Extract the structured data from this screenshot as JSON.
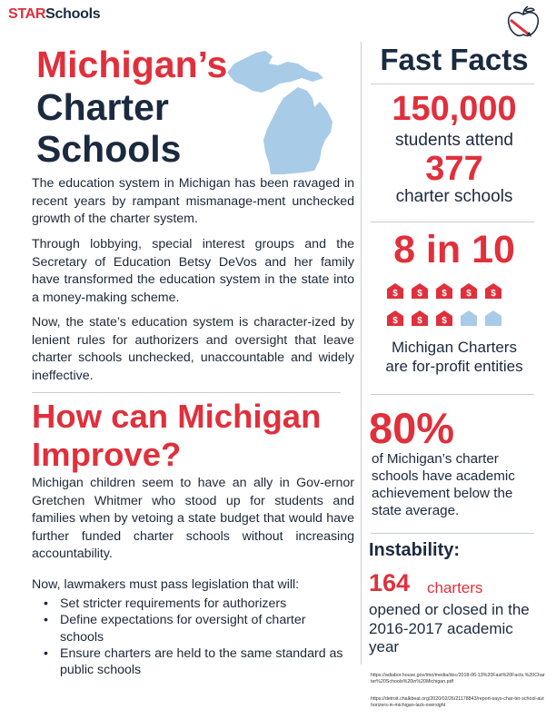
{
  "header": {
    "logo_part1": "STAR",
    "logo_part2": "Schools"
  },
  "icons": {
    "logo_decoration": "apple-pencil-icon",
    "map": "michigan-map-icon",
    "charter": "school-building-icon"
  },
  "colors": {
    "red": "#e0303c",
    "navy": "#1b2a3f",
    "light_blue": "#a8cbe8"
  },
  "left": {
    "title_line1": "Michigan’s",
    "title_line2": "Charter",
    "title_line3": "Schools",
    "paragraph1": "The education system in Michigan has been ravaged in recent years by rampant mismanage-ment unchecked growth of the charter system.",
    "paragraph2": "Through lobbying, special interest groups and the Secretary of Education Betsy DeVos and her family have transformed the education system in the state into a money-making scheme.",
    "paragraph3": "Now, the state’s education system is character-ized by lenient rules for authorizers and oversight that leave charter schools unchecked, unaccountable and widely ineffective.",
    "heading2_line1": "How can Michigan",
    "heading2_line2": "Improve?",
    "paragraph4": "Michigan children seem to have an ally in Gov-ernor Gretchen Whitmer who stood up for students and families when by vetoing a state budget that would have further funded charter schools without increasing accountability.",
    "paragraph5": "Now, lawmakers must pass legislation that will:",
    "bullets": [
      "Set stricter requirements for authorizers",
      "Define expectations for oversight of charter schools",
      "Ensure charters are held to the same standard as public schools"
    ]
  },
  "right": {
    "heading": "Fast Facts",
    "stat1_number": "150,000",
    "stat1_label": "students attend",
    "stat2_number": "377",
    "stat2_label": "charter schools",
    "stat3_number": "8 in 10",
    "stat3_fraction": 0.8,
    "stat3_label_line1": "Michigan Charters",
    "stat3_label_line2": "are for-profit entities",
    "stat4_number": "80%",
    "stat4_text": "of Michigan’s charter schools have academic achievement below the state average.",
    "instability_heading": "Instability:",
    "stat5_number": "164",
    "stat5_unit": "charters",
    "stat5_text": "opened or closed in the 2016-2017 academic year",
    "source1": "https://adiabor.house.gov/imo/media/doc/2018-06-13%20Fast%20Facts,%20Charter%20Schools%20in%20Michigan.pdf",
    "source2": "https://detroit.chalkbeat.org/2020/02/26/21178843/report-says-char-ter-school-authorizers-in-michigan-lack-oversight"
  }
}
